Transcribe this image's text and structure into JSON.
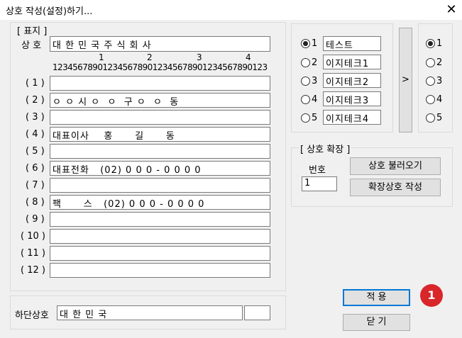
{
  "window": {
    "title": "상호 작성(설정)하기...",
    "close": "✕"
  },
  "marker_group": {
    "legend": "[ 표지 ]",
    "name_label": "상 호",
    "name_value": "대 한 민 국 주 식 회 사",
    "ruler_tens": [
      "1",
      "2",
      "3",
      "4"
    ],
    "ruler_digits": "1234567890123456789012345678901234567890123",
    "lines": [
      {
        "label": "( 1 )",
        "value": ""
      },
      {
        "label": "( 2 )",
        "value": "ㅇ ㅇ 시 ㅇ  ㅇ  구 ㅇ  ㅇ  동"
      },
      {
        "label": "( 3 )",
        "value": ""
      },
      {
        "label": "( 4 )",
        "value": "대표이사    홍      길      동"
      },
      {
        "label": "( 5 )",
        "value": ""
      },
      {
        "label": "( 6 )",
        "value": "대표전화   (02) 0 0 0 - 0 0 0 0"
      },
      {
        "label": "( 7 )",
        "value": ""
      },
      {
        "label": "( 8 )",
        "value": "팩      스   (02) 0 0 0 - 0 0 0 0"
      },
      {
        "label": "( 9 )",
        "value": ""
      },
      {
        "label": "( 10 )",
        "value": ""
      },
      {
        "label": "( 11 )",
        "value": ""
      },
      {
        "label": "( 12 )",
        "value": ""
      }
    ]
  },
  "bottom_group": {
    "label": "하단상호",
    "value": "대 한 민 국",
    "extra_value": ""
  },
  "presets": {
    "items": [
      {
        "num": "1",
        "value": "테스트",
        "selected": true
      },
      {
        "num": "2",
        "value": "이지테크1",
        "selected": false
      },
      {
        "num": "3",
        "value": "이지테크2",
        "selected": false
      },
      {
        "num": "4",
        "value": "이지테크3",
        "selected": false
      },
      {
        "num": "5",
        "value": "이지테크4",
        "selected": false
      }
    ],
    "arrow_label": ">"
  },
  "targets": {
    "items": [
      {
        "num": "1",
        "selected": true
      },
      {
        "num": "2",
        "selected": false
      },
      {
        "num": "3",
        "selected": false
      },
      {
        "num": "4",
        "selected": false
      },
      {
        "num": "5",
        "selected": false
      }
    ]
  },
  "expand_group": {
    "legend": "[ 상호 확장 ]",
    "number_label": "번호",
    "number_value": "1",
    "load_button": "상호 불러오기",
    "create_button": "확장상호 작성"
  },
  "actions": {
    "apply_button": "적 용",
    "close_button": "닫 기",
    "badge": "1"
  }
}
